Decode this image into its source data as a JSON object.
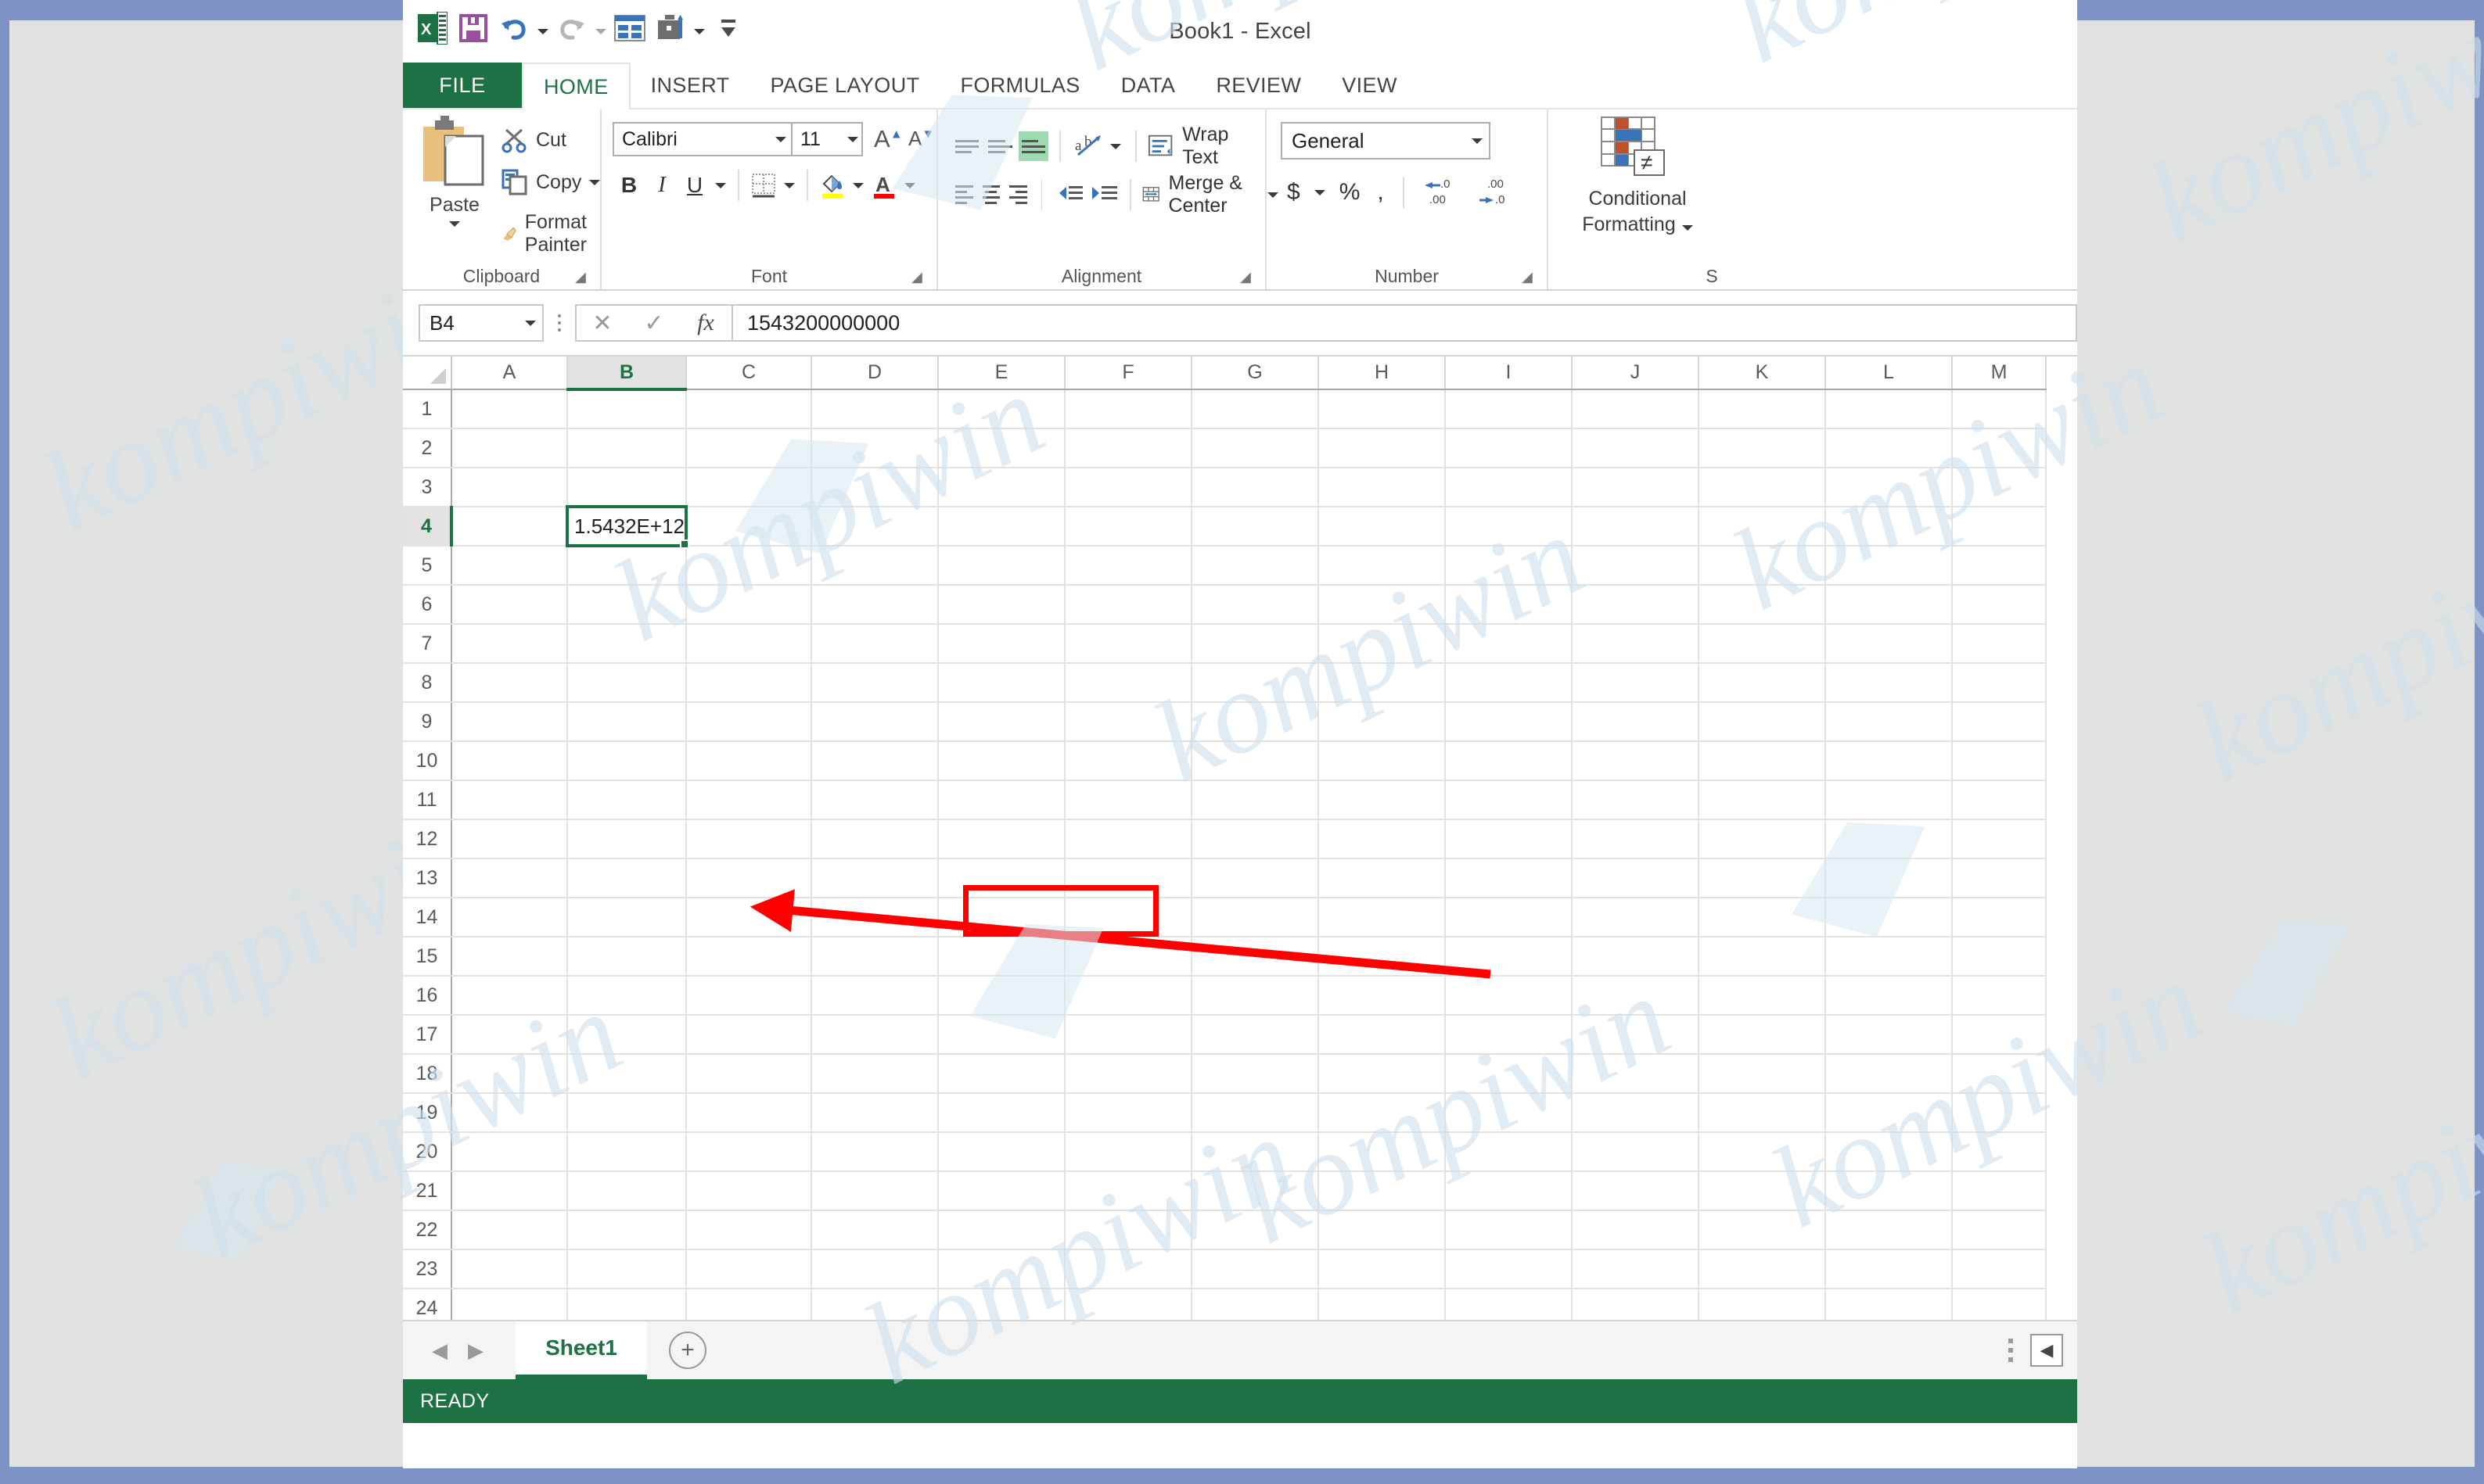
{
  "window": {
    "title": "Book1 - Excel"
  },
  "quick_access": {
    "items": [
      {
        "name": "excel-logo-icon",
        "label": "X"
      },
      {
        "name": "save-icon",
        "label": "Save"
      },
      {
        "name": "undo-icon",
        "label": "Undo"
      },
      {
        "name": "redo-icon",
        "label": "Redo"
      },
      {
        "name": "new-icon",
        "label": "New"
      },
      {
        "name": "customize-icon",
        "label": "Customize Quick Access Toolbar"
      },
      {
        "name": "ribbon-display-icon",
        "label": "Ribbon Display Options"
      }
    ]
  },
  "ribbon": {
    "file_tab": "FILE",
    "tabs": [
      {
        "label": "HOME",
        "active": true
      },
      {
        "label": "INSERT",
        "active": false
      },
      {
        "label": "PAGE LAYOUT",
        "active": false
      },
      {
        "label": "FORMULAS",
        "active": false
      },
      {
        "label": "DATA",
        "active": false
      },
      {
        "label": "REVIEW",
        "active": false
      },
      {
        "label": "VIEW",
        "active": false
      }
    ],
    "clipboard": {
      "group_label": "Clipboard",
      "paste": "Paste",
      "cut": "Cut",
      "copy": "Copy",
      "format_painter": "Format Painter"
    },
    "font": {
      "group_label": "Font",
      "font_name": "Calibri",
      "font_size": "11",
      "bold": "B",
      "italic": "I",
      "underline": "U",
      "grow_font": "A",
      "shrink_font": "A",
      "font_color_letter": "A"
    },
    "alignment": {
      "group_label": "Alignment",
      "wrap_text": "Wrap Text",
      "merge_center": "Merge & Center"
    },
    "number": {
      "group_label": "Number",
      "format": "General",
      "currency": "$",
      "percent": "%",
      "comma": ",",
      "increase_decimal": ".00",
      "decrease_decimal": ".00"
    },
    "styles": {
      "group_label": "S",
      "conditional_formatting_line1": "Conditional",
      "conditional_formatting_line2": "Formatting"
    }
  },
  "formula_bar": {
    "name_box": "B4",
    "cancel": "✕",
    "enter": "✓",
    "insert_function": "fx",
    "value": "1543200000000"
  },
  "sheet": {
    "columns": [
      "A",
      "B",
      "C",
      "D",
      "E",
      "F",
      "G",
      "H",
      "I",
      "J",
      "K",
      "L",
      "M"
    ],
    "rows": [
      "1",
      "2",
      "3",
      "4",
      "5",
      "6",
      "7",
      "8",
      "9",
      "10",
      "11",
      "12",
      "13",
      "14",
      "15",
      "16",
      "17",
      "18",
      "19",
      "20",
      "21",
      "22",
      "23",
      "24"
    ],
    "selected_column": "B",
    "selected_row": "4",
    "active_cell": {
      "ref": "B4",
      "display_value": "1.5432E+12"
    }
  },
  "sheet_tabs": {
    "prev": "◀",
    "next": "▶",
    "tabs": [
      {
        "label": "Sheet1",
        "active": true
      }
    ],
    "add_sheet": "+",
    "scroll_left": "◀"
  },
  "status_bar": {
    "mode": "READY"
  },
  "annotation": {
    "highlight_cell": "B4",
    "color": "#ff0000"
  },
  "watermark": {
    "text": "kompiwin",
    "color": "#cfe0ec"
  },
  "colors": {
    "accent_green": "#1e7145",
    "desktop_blue": "#7e92c6",
    "desktop_gray": "#e0e1e1",
    "annotation_red": "#ff0000"
  }
}
